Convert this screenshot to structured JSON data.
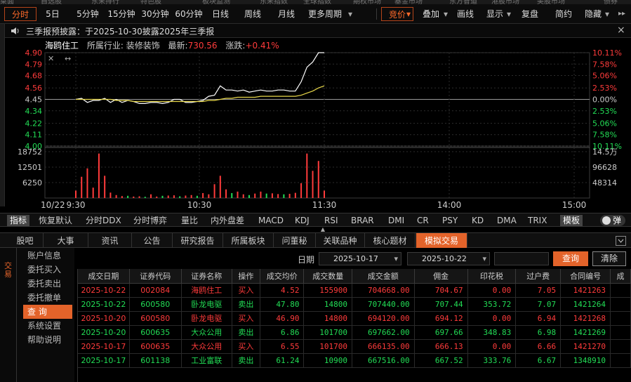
{
  "top_nav": [
    "桌面",
    "自选股",
    "东来排行",
    "特色股",
    "板块监测",
    "东来指数",
    "全球指数",
    "期权市场",
    "基金市场",
    "东方智道",
    "港股市场",
    "美股市场",
    "债券"
  ],
  "toolbar": {
    "left": [
      "分时",
      "5日",
      "5分钟",
      "15分钟",
      "30分钟",
      "60分钟",
      "日线",
      "周线",
      "月线",
      "更多周期"
    ],
    "right": [
      "竞价",
      "叠加",
      "画线",
      "显示",
      "复盘",
      "简约",
      "隐藏"
    ]
  },
  "notice": {
    "text": "三季报预披露：于2025-10-30披露2025年三季报",
    "close": "×"
  },
  "stock": {
    "name": "海鸥住工",
    "industry": "所属行业: 装修装饰",
    "latest_label": "最新:",
    "latest": "730.56",
    "change_label": "涨跌:",
    "change": "+0.41%"
  },
  "chart_data": {
    "type": "line",
    "price_axis_left": [
      "4.90",
      "4.79",
      "4.68",
      "4.56",
      "4.45",
      "4.34",
      "4.22",
      "4.11",
      "4.00"
    ],
    "price_axis_right": [
      "10.11%",
      "7.58%",
      "5.06%",
      "2.53%",
      "0.00%",
      "2.53%",
      "5.06%",
      "7.58%",
      "10.11%"
    ],
    "prev_close": 4.45,
    "volume_axis_left": [
      "18752",
      "12501",
      "6250"
    ],
    "volume_axis_right": [
      "14.5万",
      "96628",
      "48314"
    ],
    "time_axis": [
      "10/22",
      "9:30",
      "10:30",
      "11:30",
      "14:00",
      "15:00"
    ],
    "series": [
      {
        "values": [
          4.45,
          4.46,
          4.42,
          4.44,
          4.44,
          4.46,
          4.42,
          4.45,
          4.42,
          4.44,
          4.43,
          4.41,
          4.41,
          4.42,
          4.42,
          4.41,
          4.42,
          4.45,
          4.45,
          4.42,
          4.42,
          4.43,
          4.44,
          4.48,
          4.49,
          4.58,
          4.54,
          4.54,
          4.53,
          4.54,
          4.52,
          4.53,
          4.54,
          4.53,
          4.53,
          4.54,
          4.54,
          4.53,
          4.53,
          4.62,
          4.76,
          4.81,
          4.9,
          4.9
        ]
      },
      {
        "values": [
          4.45,
          4.45,
          4.45,
          4.45,
          4.45,
          4.45,
          4.45,
          4.44,
          4.44,
          4.44,
          4.43,
          4.43,
          4.43,
          4.43,
          4.43,
          4.43,
          4.43,
          4.43,
          4.43,
          4.43,
          4.43,
          4.43,
          4.43,
          4.44,
          4.44,
          4.45,
          4.46,
          4.46,
          4.47,
          4.47,
          4.47,
          4.47,
          4.48,
          4.48,
          4.48,
          4.48,
          4.48,
          4.48,
          4.48,
          4.49,
          4.51,
          4.53,
          4.56,
          4.58
        ]
      }
    ],
    "volume": [
      3000,
      8600,
      12000,
      4200,
      18000,
      9000,
      2200,
      1200,
      800,
      900,
      600,
      700,
      500,
      1500,
      600,
      900,
      1000,
      1100,
      700,
      1000,
      1200,
      900,
      2000,
      1500,
      5600,
      9000,
      3500,
      2000,
      2600,
      1500,
      1200,
      1800,
      2600,
      1800,
      1900,
      1600,
      1500,
      1700,
      2100,
      6000,
      18000,
      11000,
      15000,
      3000
    ]
  },
  "indicators": [
    "指标",
    "恢复默认",
    "分时DDX",
    "分时博弈",
    "量比",
    "内外盘差",
    "MACD",
    "KDJ",
    "RSI",
    "BRAR",
    "DMI",
    "CR",
    "PSY",
    "KD",
    "DMA",
    "TRIX",
    "模板",
    "弹"
  ],
  "bottom_tabs": [
    "股吧",
    "大事",
    "资讯",
    "公告",
    "研究报告",
    "所属板块",
    "问董秘",
    "关联品种",
    "核心题材",
    "模拟交易"
  ],
  "sidebar": {
    "vertical_label": "交易",
    "items": [
      "账户信息",
      "委托买入",
      "委托卖出",
      "委托撤单",
      "查  询",
      "系统设置",
      "帮助说明"
    ]
  },
  "filters": {
    "date_label": "日期",
    "start": "2025-10-17",
    "end": "2025-10-22",
    "query": "查询",
    "clear": "清除"
  },
  "table": {
    "headers": [
      "成交日期",
      "证券代码",
      "证券名称",
      "操作",
      "成交均价",
      "成交数量",
      "成交金额",
      "佣金",
      "印花税",
      "过户费",
      "合同编号",
      "成"
    ],
    "rows": [
      [
        "2025-10-22",
        "002084",
        "海鸥住工",
        "买入",
        "4.52",
        "155900",
        "704668.00",
        "704.67",
        "0.00",
        "7.05",
        "1421263"
      ],
      [
        "2025-10-22",
        "600580",
        "卧龙电驱",
        "卖出",
        "47.80",
        "14800",
        "707440.00",
        "707.44",
        "353.72",
        "7.07",
        "1421264"
      ],
      [
        "2025-10-20",
        "600580",
        "卧龙电驱",
        "买入",
        "46.90",
        "14800",
        "694120.00",
        "694.12",
        "0.00",
        "6.94",
        "1421268"
      ],
      [
        "2025-10-20",
        "600635",
        "大众公用",
        "卖出",
        "6.86",
        "101700",
        "697662.00",
        "697.66",
        "348.83",
        "6.98",
        "1421269"
      ],
      [
        "2025-10-17",
        "600635",
        "大众公用",
        "买入",
        "6.55",
        "101700",
        "666135.00",
        "666.13",
        "0.00",
        "6.66",
        "1421270"
      ],
      [
        "2025-10-17",
        "601138",
        "工业富联",
        "卖出",
        "61.24",
        "10900",
        "667516.00",
        "667.52",
        "333.76",
        "6.67",
        "1348910"
      ]
    ]
  },
  "colors": {
    "accent": "#e3632a",
    "up": "#ff3b3b",
    "down": "#22dd55",
    "price_line": "#ffffff",
    "avg_line": "#e8d84a"
  }
}
